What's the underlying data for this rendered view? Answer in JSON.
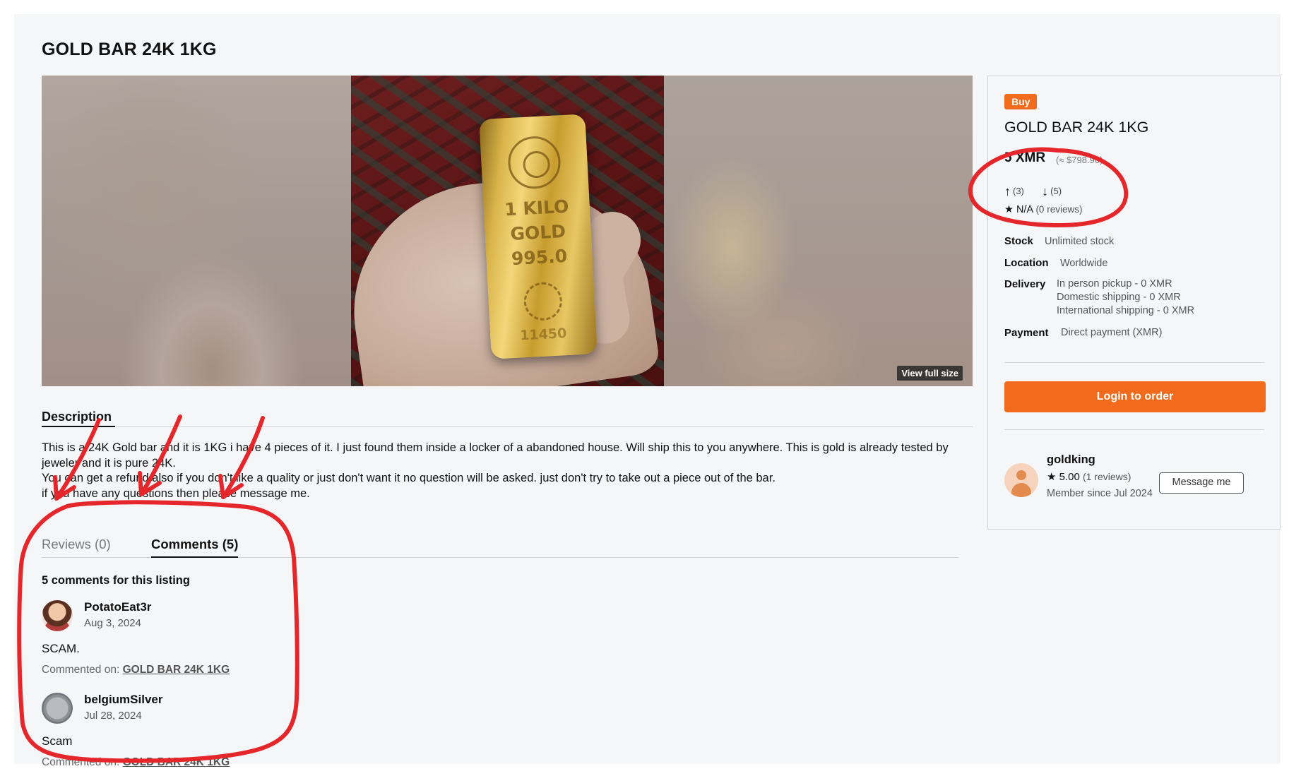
{
  "listing": {
    "title": "GOLD BAR 24K 1KG",
    "view_full_size": "View full size",
    "image_text": {
      "line1": "1 KILO",
      "line2": "GOLD",
      "line3": "995.0",
      "line4": "11450"
    }
  },
  "description": {
    "heading": "Description",
    "paragraphs": [
      "This is a 24K Gold bar and it is 1KG i have 4 pieces of it. I just found them inside a locker of a abandoned house. Will ship this to you anywhere. This is gold is already tested by jeweler and it is pure 24K.",
      "You can get a refund also if you don't like a quality or just don't want it no question will be asked. just don't try to take out a piece out of the bar.",
      "if you have any questions then please message me."
    ]
  },
  "tabs": {
    "reviews": "Reviews (0)",
    "comments": "Comments (5)"
  },
  "comments": {
    "count_label": "5 comments for this listing",
    "items": [
      {
        "user": "PotatoEat3r",
        "date": "Aug 3, 2024",
        "text": "SCAM.",
        "on_prefix": "Commented on:",
        "on_link": "GOLD BAR 24K 1KG"
      },
      {
        "user": "belgiumSilver",
        "date": "Jul 28, 2024",
        "text": "Scam",
        "on_prefix": "Commented on:",
        "on_link": "GOLD BAR 24K 1KG"
      }
    ]
  },
  "sidebar": {
    "badge": "Buy",
    "title": "GOLD BAR 24K 1KG",
    "price": "5 XMR",
    "price_usd": "(≈ $798.90)",
    "upvotes": "(3)",
    "downvotes": "(5)",
    "rating": "N/A",
    "rating_reviews": "(0 reviews)",
    "stock_label": "Stock",
    "stock_value": "Unlimited stock",
    "location_label": "Location",
    "location_value": "Worldwide",
    "delivery_label": "Delivery",
    "delivery_options": [
      "In person pickup - 0 XMR",
      "Domestic shipping - 0 XMR",
      "International shipping - 0 XMR"
    ],
    "payment_label": "Payment",
    "payment_value": "Direct payment (XMR)",
    "order_button": "Login to order",
    "seller": {
      "name": "goldking",
      "rating": "5.00",
      "reviews": "(1 reviews)",
      "member_since": "Member since Jul 2024",
      "message_button": "Message me"
    }
  },
  "colors": {
    "accent": "#f26a1b",
    "annotation": "#e5262b",
    "background": "#f5f6f8"
  }
}
